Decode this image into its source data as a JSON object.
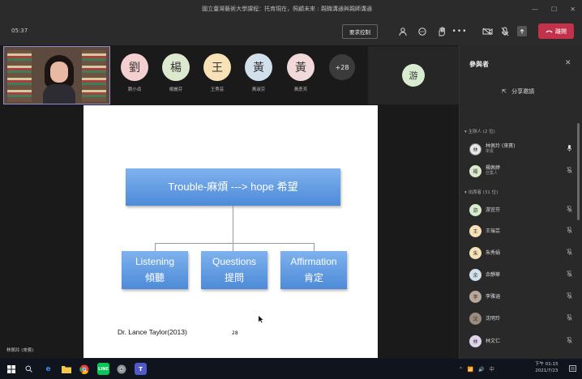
{
  "window": {
    "title": "國立臺灣藝術大學課程：托育現在，照顧未來 : 親職溝通與親師溝通",
    "minimize": "—",
    "maximize": "☐",
    "close": "✕"
  },
  "toolbar": {
    "timer": "05:37",
    "request_control": "要求控制",
    "leave": "離開"
  },
  "participants_strip": [
    {
      "initial": "劉",
      "name": "劉小貞",
      "color": "#f3cfcf"
    },
    {
      "initial": "楊",
      "name": "楊麗芬",
      "color": "#dce9cf"
    },
    {
      "initial": "王",
      "name": "王秀芸",
      "color": "#f6e2b6"
    },
    {
      "initial": "黃",
      "name": "黃淑芬",
      "color": "#d2e0ec"
    },
    {
      "initial": "黃",
      "name": "黃彥芳",
      "color": "#f1d9d9"
    }
  ],
  "more_count": "+28",
  "pinned_initial": "游",
  "video_caption": "林佩玲 (來賓)",
  "slide": {
    "main_box": "Trouble-麻煩 ---> hope 希望",
    "boxes": [
      {
        "en": "Listening",
        "zh": "傾聽"
      },
      {
        "en": "Questions",
        "zh": "提問"
      },
      {
        "en": "Affirmation",
        "zh": "肯定"
      }
    ],
    "credit": "Dr. Lance Taylor(2013)",
    "page": "28"
  },
  "panel": {
    "title": "參與者",
    "share": "分享邀請",
    "organizers_header": "主辦人 (2 位)",
    "attendees_header": "出席者 (31 位)",
    "organizers": [
      {
        "initial": "林",
        "name": "林佩玲 (來賓)",
        "role": "來賓",
        "color": "#e8e8e8",
        "mic": "🎙"
      },
      {
        "initial": "楊",
        "name": "楊佩婷",
        "role": "召集人",
        "color": "#dce9cf",
        "mic": "🔇"
      }
    ],
    "attendees": [
      {
        "initial": "游",
        "name": "游宜芬",
        "color": "#d8ecd0"
      },
      {
        "initial": "王",
        "name": "王瑞芸",
        "color": "#f6e2b6"
      },
      {
        "initial": "朱",
        "name": "朱秀娟",
        "color": "#f6e2b6"
      },
      {
        "initial": "余",
        "name": "余靜華",
        "color": "#d2e0ec"
      },
      {
        "initial": "李",
        "name": "李雅涵",
        "color": "#b9a79a"
      },
      {
        "initial": "沈",
        "name": "沈明玲",
        "color": "#9a8d7f"
      },
      {
        "initial": "林",
        "name": "林文仁",
        "color": "#e0d4ec"
      }
    ]
  },
  "taskbar": {
    "tray": "^ 📶 🔊 中",
    "time": "下午 01:15",
    "date": "2021/7/23"
  }
}
